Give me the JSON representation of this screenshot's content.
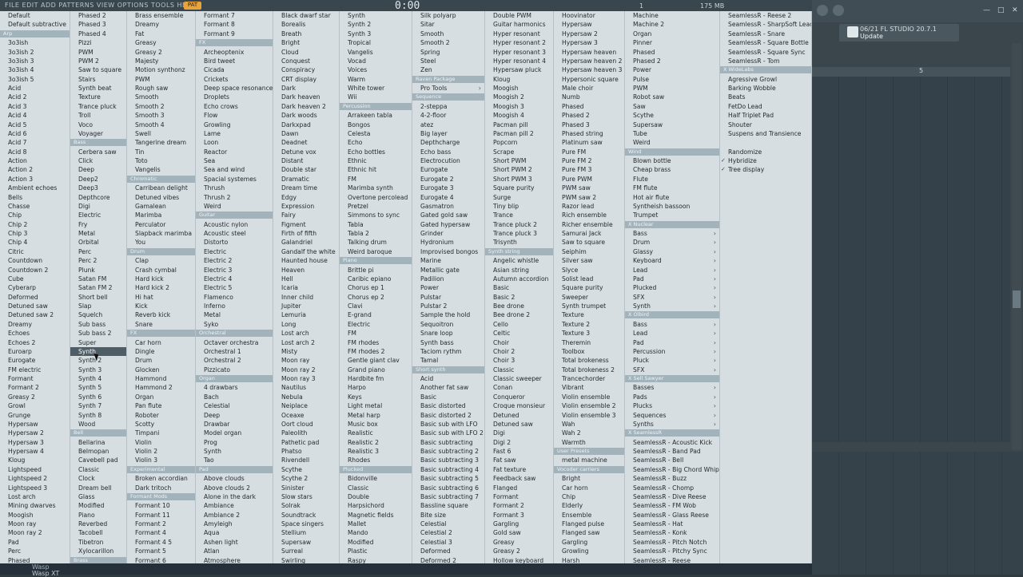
{
  "topbar": {
    "menu": "FILE  EDIT  ADD  PATTERNS  VIEW  OPTIONS  TOOLS  HELP",
    "pat": "PAT",
    "time": "0:00",
    "bar": "1",
    "memory": "175 MB"
  },
  "news": {
    "date": "06/21",
    "title": "FL STUDIO 20.7.1",
    "sub": "Update"
  },
  "ruler_mark": "5",
  "bottom": {
    "line1": "Wasp",
    "line2": "Wasp XT"
  },
  "columns": [
    [
      "Default",
      "Default subtractive",
      "#Arp",
      "3o3ish",
      "3o3ish 2",
      "3o3ish 3",
      "3o3ish 4",
      "3o3ish 5",
      "Acid",
      "Acid 2",
      "Acid 3",
      "Acid 4",
      "Acid 5",
      "Acid 6",
      "Acid 7",
      "Acid 8",
      "Action",
      "Action 2",
      "Action 3",
      "Ambient echoes",
      "Bells",
      "Chasse",
      "Chip",
      "Chip 2",
      "Chip 3",
      "Chip 4",
      "Citric",
      "Countdown",
      "Countdown 2",
      "Cube",
      "Cyberarp",
      "Deformed",
      "Detuned saw",
      "Detuned saw 2",
      "Dreamy",
      "Echoes",
      "Echoes 2",
      "Euroarp",
      "Eurogate",
      "FM electric",
      "Formant",
      "Formant 2",
      "Greasy 2",
      "Growl",
      "Grunge",
      "Hypersaw",
      "Hypersaw 2",
      "Hypersaw 3",
      "Hypersaw 4",
      "Kloug",
      "Lightspeed",
      "Lightspeed 2",
      "Lightspeed 3",
      "Lost arch",
      "Mining dwarves",
      "Moogish",
      "Moon ray",
      "Moon ray 2",
      "Pad",
      "Perc",
      "Phased"
    ],
    [
      "Phased 2",
      "Phased 3",
      "Phased 4",
      "Pizzi",
      "PWM",
      "PWM 2",
      "Saw to square",
      "Stairs",
      "Synth beat",
      "Texture",
      "Trance pluck",
      "Troll",
      "Voco",
      "Voyager",
      "#Bass",
      "Cerbera saw",
      "Click",
      "Deep",
      "Deep2",
      "Deep3",
      "Depthcore",
      "Digi",
      "Electric",
      "Fry",
      "Metal",
      "Orbital",
      "Perc",
      "Perc 2",
      "Plunk",
      "Satan FM",
      "Satan FM 2",
      "Short bell",
      "Slap",
      "Squelch",
      "Sub bass",
      "Sub bass 2",
      "Super",
      "*Synth",
      "Synth 2",
      "Synth 3",
      "Synth 4",
      "Synth 5",
      "Synth 6",
      "Synth 7",
      "Synth 8",
      "Wood",
      "#Bell",
      "Bellarina",
      "Belmopan",
      "Cavebell pad",
      "Classic",
      "Clock",
      "Dream bell",
      "Glass",
      "Modified",
      "Piano",
      "Reverbed",
      "Tacobell",
      "Tibetron",
      "Xylocarillon",
      "#Brass"
    ],
    [
      "Brass ensemble",
      "Dreamy",
      "Fat",
      "Greasy",
      "Greasy 2",
      "Majesty",
      "Motion synthonz",
      "PWM",
      "Rough saw",
      "Smooth",
      "Smooth 2",
      "Smooth 3",
      "Smooth 4",
      "Swell",
      "Tangerine dream",
      "Tin",
      "Toto",
      "Vangelis",
      "#Chromatic",
      "Carribean delight",
      "Detuned vibes",
      "Gamalean",
      "Marimba",
      "Perculator",
      "Slapback marimba",
      "You",
      "#Drum",
      "Clap",
      "Crash cymbal",
      "Hard kick",
      "Hard kick 2",
      "Hi hat",
      "Kick",
      "Reverb kick",
      "Snare",
      "#FX",
      "Car horn",
      "Dingle",
      "Drum",
      "Glocken",
      "Hammond",
      "Hammond 2",
      "Organ",
      "Pan flute",
      "Roboter",
      "Scotty",
      "Timpani",
      "Violin",
      "Violin 2",
      "Violin 3",
      "#Experimental",
      "Broken accordian",
      "Dark tritoch",
      "#Formant Mods",
      "Formant 10",
      "Formant 11",
      "Formant 2",
      "Formant 4",
      "Formant 4 5",
      "Formant 5",
      "Formant 6"
    ],
    [
      "Formant 7",
      "Formant 8",
      "Formant 9",
      "#FX",
      "Archeoptenix",
      "Bird tweet",
      "Cicada",
      "Crickets",
      "Deep space resonance",
      "Droplets",
      "Echo crows",
      "Flow",
      "Growling",
      "Lame",
      "Loon",
      "Reactor",
      "Sea",
      "Sea and wind",
      "Spacial systemes",
      "Thrush",
      "Thrush 2",
      "Weird",
      "#Guitar",
      "Acoustic nylon",
      "Acoustic steel",
      "Distorto",
      "Electric",
      "Electric 2",
      "Electric 3",
      "Electric 4",
      "Electric 5",
      "Flamenco",
      "Inferno",
      "Metal",
      "Syko",
      "#Orchestral",
      "Octaver orchestra",
      "Orchestral 1",
      "Orchestral 2",
      "Pizzicato",
      "#Organ",
      "4 drawbars",
      "Bach",
      "Celestial",
      "Deep",
      "Drawbar",
      "Model organ",
      "Prog",
      "Synth",
      "Tao",
      "#Pad",
      "Above clouds",
      "Above clouds 2",
      "Alone in the dark",
      "Ambiance",
      "Ambiance 2",
      "Amyleigh",
      "Aqua",
      "Ashen light",
      "Atlan",
      "Atmosphere"
    ],
    [
      "Black dwarf star",
      "Borealis",
      "Breath",
      "Bright",
      "Cloud",
      "Conquest",
      "Conspiracy",
      "CRT display",
      "Dark",
      "Dark heaven",
      "Dark heaven 2",
      "Dark woods",
      "Darkxpad",
      "Dawn",
      "Deadnet",
      "Detune vox",
      "Distant",
      "Double star",
      "Dramatic",
      "Dream time",
      "Edgy",
      "Expression",
      "Fairy",
      "Figment",
      "Firth of fifth",
      "Galandriel",
      "Gandalf the white",
      "Haunted house",
      "Heaven",
      "Hell",
      "Icaria",
      "Inner child",
      "Jupiter",
      "Lemuria",
      "Long",
      "Lost arch",
      "Lost arch 2",
      "Misty",
      "Moon ray",
      "Moon ray 2",
      "Moon ray 3",
      "Nautilus",
      "Nebula",
      "Neiplace",
      "Oceaxe",
      "Oort cloud",
      "Paleolith",
      "Pathetic pad",
      "Phatso",
      "Rivendell",
      "Scythe",
      "Scythe 2",
      "Sinister",
      "Slow stars",
      "Solrak",
      "Soundtrack",
      "Space singers",
      "Stellium",
      "Supersaw",
      "Surreal",
      "Swirling"
    ],
    [
      "Synth",
      "Synth 2",
      "Synth 3",
      "Tropical",
      "Vangelis",
      "Vocad",
      "Voices",
      "Warm",
      "White tower",
      "Wii",
      "#Percussion",
      "Arrakeen tabla",
      "Bongos",
      "Celesta",
      "Echo",
      "Echo bottles",
      "Ethnic",
      "Ethnic hit",
      "FM",
      "Marimba synth",
      "Overtone percolead",
      "Pretzel",
      "Simmons to sync",
      "Tabla",
      "Tabla 2",
      "Talking drum",
      "Weird baroque",
      "#Piano",
      "Brittle pi",
      "Caribic epiano",
      "Chorus ep 1",
      "Chorus ep 2",
      "Clavi",
      "E-grand",
      "Electric",
      "FM",
      "FM rhodes",
      "FM rhodes 2",
      "Gentle giant clav",
      "Grand piano",
      "Hardbite fm",
      "Harpo",
      "Keys",
      "Light metal",
      "Metal harp",
      "Music box",
      "Realistic",
      "Realistic 2",
      "Realistic 3",
      "Rhodes",
      "#Plucked",
      "Bidonville",
      "Classic",
      "Double",
      "Harpsichord",
      "Magnetic fields",
      "Mallet",
      "Mando",
      "Modified",
      "Plastic",
      "Raspy"
    ],
    [
      "Silk polyarp",
      "Sitar",
      "Smooth",
      "Smooth 2",
      "Spring",
      "Steel",
      "Zen",
      "#Raven Package",
      "Pro Tools >",
      "#Sequence",
      "2-steppa",
      "4-2-floor",
      "atez",
      "Big layer",
      "Depthcharge",
      "Echo bass",
      "Electrocution",
      "Eurogate",
      "Eurogate 2",
      "Eurogate 3",
      "Eurogate 4",
      "Gasmatron",
      "Gated gold saw",
      "Gated hypersaw",
      "Grinder",
      "Hydronium",
      "Improvised bongos",
      "Marine",
      "Metallic gate",
      "Padilion",
      "Power",
      "Pulstar",
      "Pulstar 2",
      "Sample the hold",
      "Sequoitron",
      "Snare loop",
      "Synth bass",
      "Taciom rythm",
      "Tamal",
      "#Short synth",
      "Acid",
      "Another fat saw",
      "Basic",
      "Basic distorted",
      "Basic distorted 2",
      "Basic sub with LFO",
      "Basic sub with LFO 2",
      "Basic subtracting",
      "Basic subtracting 2",
      "Basic subtracting 3",
      "Basic subtracting 4",
      "Basic subtracting 5",
      "Basic subtracting 6",
      "Basic subtracting 7",
      "Bassline square",
      "Bite size",
      "Celestial",
      "Celestial 2",
      "Celestial 3",
      "Deformed",
      "Deformed 2"
    ],
    [
      "Double PWM",
      "Guitar harmonics",
      "Hyper resonant",
      "Hyper resonant 2",
      "Hyper resonant 3",
      "Hyper resonant 4",
      "Hypersaw pluck",
      "Kloug",
      "Moogish",
      "Moogish 2",
      "Moogish 3",
      "Moogish 4",
      "Pacman pill",
      "Pacman pill 2",
      "Popcorn",
      "Scrape",
      "Short PWM",
      "Short PWM 2",
      "Short PWM 3",
      "Square purity",
      "Surge",
      "Tiny blip",
      "Trance",
      "Trance pluck 2",
      "Trance pluck 3",
      "Trisynth",
      "#Synth string",
      "Angelic whistle",
      "Asian string",
      "Autumn accordion",
      "Basic",
      "Basic 2",
      "Bee drone",
      "Bee drone 2",
      "Cello",
      "Celtic",
      "Choir",
      "Choir 2",
      "Choir 3",
      "Classic",
      "Classic sweeper",
      "Conan",
      "Conqueror",
      "Croque monsieur",
      "Detuned",
      "Detuned saw",
      "Digi",
      "Digi 2",
      "Fast 6",
      "Fat saw",
      "Fat texture",
      "Feedback saw",
      "Flanged",
      "Formant",
      "Formant 2",
      "Formant 3",
      "Gargling",
      "Gold saw",
      "Greasy",
      "Greasy 2",
      "Hollow keyboard"
    ],
    [
      "Hoovinator",
      "Hypersaw",
      "Hypersaw 2",
      "Hypersaw 3",
      "Hypersaw heaven",
      "Hypersaw heaven 2",
      "Hypersaw heaven 3",
      "Hypersonic square",
      "Male choir",
      "Numb",
      "Phased",
      "Phased 2",
      "Phased 3",
      "Phased string",
      "Platinum saw",
      "Pure FM",
      "Pure FM 2",
      "Pure FM 3",
      "Pure PWM",
      "PWM saw",
      "PWM saw 2",
      "Razor lead",
      "Rich ensemble",
      "Richer ensemble",
      "Samurai Jack",
      "Saw to square",
      "Seiphim",
      "Silver saw",
      "Slyce",
      "Solist lead",
      "Square purity",
      "Sweeper",
      "Synth trumpet",
      "Texture",
      "Texture 2",
      "Texture 3",
      "Theremin",
      "Toolbox",
      "Total brokeness",
      "Total brokeness 2",
      "Trancechorder",
      "Vibrant",
      "Violin ensemble",
      "Violin ensemble 2",
      "Violin ensemble 3",
      "Wah",
      "Wah 2",
      "Warmth",
      "#User Presets",
      "metal machine",
      "#Vocoder carriers",
      "Bright",
      "Car horn",
      "Chip",
      "Elderly",
      "Ensemble",
      "Flanged pulse",
      "Flanged saw",
      "Gargling",
      "Growling",
      "Harsh"
    ],
    [
      "Machine",
      "Machine 2",
      "Organ",
      "Pinner",
      "Phased",
      "Phased 2",
      "Power",
      "Pulse",
      "PWM",
      "Robot saw",
      "Saw",
      "Scythe",
      "Supersaw",
      "Tube",
      "Weird",
      "#Wind",
      "Blown bottle",
      "Cheap brass",
      "Flute",
      "FM flute",
      "Hot air flute",
      "Syntheish bassoon",
      "Trumpet",
      "#X Nuclear",
      "Bass >",
      "Drum >",
      "Glassy >",
      "Keyboard >",
      "Lead >",
      "Pad >",
      "Plucked >",
      "SFX >",
      "Synth >",
      "#X Olbird",
      "Bass >",
      "Lead >",
      "Pad >",
      "Percussion >",
      "Pluck >",
      "SFX >",
      "#X Sell Sawyer",
      "Basses >",
      "Pads >",
      "Plucks >",
      "Sequences >",
      "Synths >",
      "#X SeamlessR",
      "SeamlessR - Acoustic Kick",
      "SeamlessR - Band Pad",
      "SeamlessR - Bell",
      "SeamlessR - Big Chord Whip",
      "SeamlessR - Buzz",
      "SeamlessR - Chomp",
      "SeamlessR - Dive Reese",
      "SeamlessR - FM Wob",
      "SeamlessR - Glass Reese",
      "SeamlessR - Hat",
      "SeamlessR - Konk",
      "SeamlessR - Pitch Notch",
      "SeamlessR - Pitchy Sync",
      "SeamlessR - Reese"
    ],
    [
      "SeamlessR - Reese 2",
      "SeamlessR - SharpSoft Lead",
      "SeamlessR - Snare",
      "SeamlessR - Square Bottle",
      "SeamlessR - Square Sync",
      "SeamlessR - Tom",
      "#X WideLabs",
      "Agressive Growl",
      "Barking Wobble",
      "Beats",
      "FetDo Lead",
      "Half Triplet Pad",
      "Shouter",
      "Suspens and Transience",
      "",
      "Randomize",
      "+Hybridize",
      "+Tree display"
    ]
  ]
}
